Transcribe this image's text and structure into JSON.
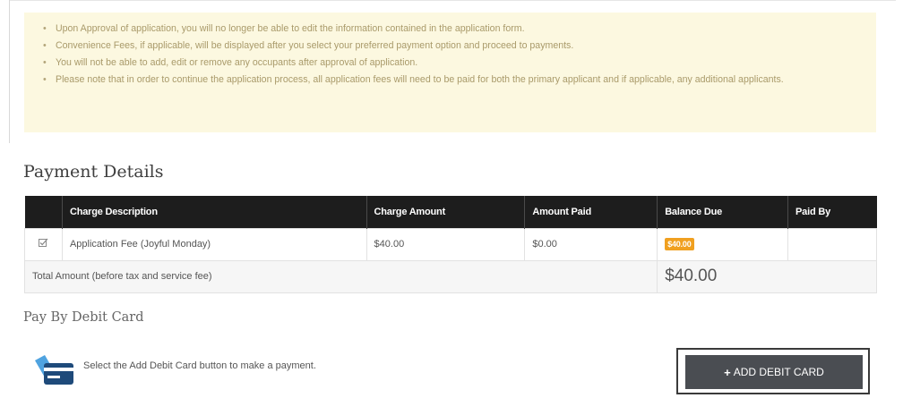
{
  "notice": {
    "items": [
      "Upon Approval of application, you will no longer be able to edit the information contained in the application form.",
      "Convenience Fees, if applicable, will be displayed after you select your preferred payment option and proceed to payments.",
      "You will not be able to add, edit or remove any occupants after approval of application.",
      "Please note that in order to continue the application process, all application fees will need to be paid for both the primary applicant and if applicable, any additional applicants."
    ]
  },
  "payment_details": {
    "title": "Payment Details",
    "columns": [
      "Charge Description",
      "Charge Amount",
      "Amount Paid",
      "Balance Due",
      "Paid By"
    ],
    "rows": [
      {
        "checked": true,
        "description": "Application Fee (Joyful Monday)",
        "charge_amount": "$40.00",
        "amount_paid": "$0.00",
        "balance_due": "$40.00",
        "paid_by": ""
      }
    ],
    "total_label": "Total Amount (before tax and service fee)",
    "total_value": "$40.00"
  },
  "debit": {
    "title": "Pay By Debit Card",
    "instruction": "Select the Add Debit Card button to make a payment.",
    "button_label": "ADD DEBIT CARD",
    "button_icon": "plus-icon",
    "card_icon": "credit-card-icon"
  },
  "colors": {
    "notice_bg": "#fcf8e0",
    "notice_text": "#a99a6a",
    "table_header_bg": "#1d1d1d",
    "badge_bg": "#f0a020",
    "button_bg": "#4a4d52"
  }
}
